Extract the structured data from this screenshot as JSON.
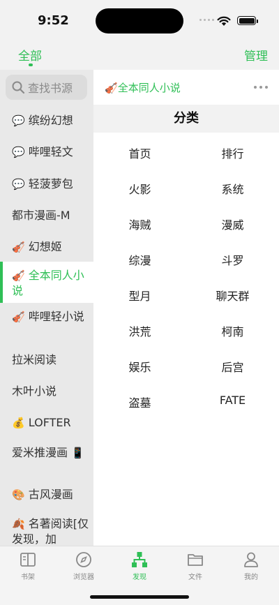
{
  "status": {
    "time": "9:52"
  },
  "nav": {
    "tab_all": "全部",
    "manage": "管理"
  },
  "sidebar": {
    "search_placeholder": "查找书源",
    "items": [
      {
        "icon": "💬",
        "label": "缤纷幻想"
      },
      {
        "icon": "💬",
        "label": "哔哩轻文"
      },
      {
        "icon": "💬",
        "label": "轻菠萝包"
      },
      {
        "icon": "",
        "label": "都市漫画-M"
      },
      {
        "icon": "🎻",
        "label": "幻想姬"
      },
      {
        "icon": "🎻",
        "label": "全本同人小说",
        "active": true
      },
      {
        "icon": "🎻",
        "label": "哔哩轻小说"
      },
      {
        "icon": "",
        "label": "拉米阅读"
      },
      {
        "icon": "",
        "label": "木叶小说"
      },
      {
        "icon": "💰",
        "label": "LOFTER"
      },
      {
        "icon": "📱",
        "label": "爱米推漫画"
      },
      {
        "icon": "🎨",
        "label": "古风漫画"
      },
      {
        "icon": "🍂",
        "label": "名著阅读[仅发现，加"
      }
    ]
  },
  "main": {
    "source_icon": "🎻",
    "source_title": "全本同人小说",
    "category_heading": "分类",
    "categories": [
      "首页",
      "排行",
      "火影",
      "系统",
      "海贼",
      "漫威",
      "综漫",
      "斗罗",
      "型月",
      "聊天群",
      "洪荒",
      "柯南",
      "娱乐",
      "后宫",
      "盗墓",
      "FATE"
    ]
  },
  "tabbar": {
    "items": [
      {
        "label": "书架",
        "icon": "bookshelf-icon"
      },
      {
        "label": "浏览器",
        "icon": "compass-icon"
      },
      {
        "label": "发现",
        "icon": "discover-icon",
        "active": true
      },
      {
        "label": "文件",
        "icon": "folder-icon"
      },
      {
        "label": "我的",
        "icon": "person-icon"
      }
    ]
  },
  "colors": {
    "accent": "#2fbf56",
    "sidebar_bg": "#e9e9e9",
    "band_bg": "#f2f2f2"
  }
}
